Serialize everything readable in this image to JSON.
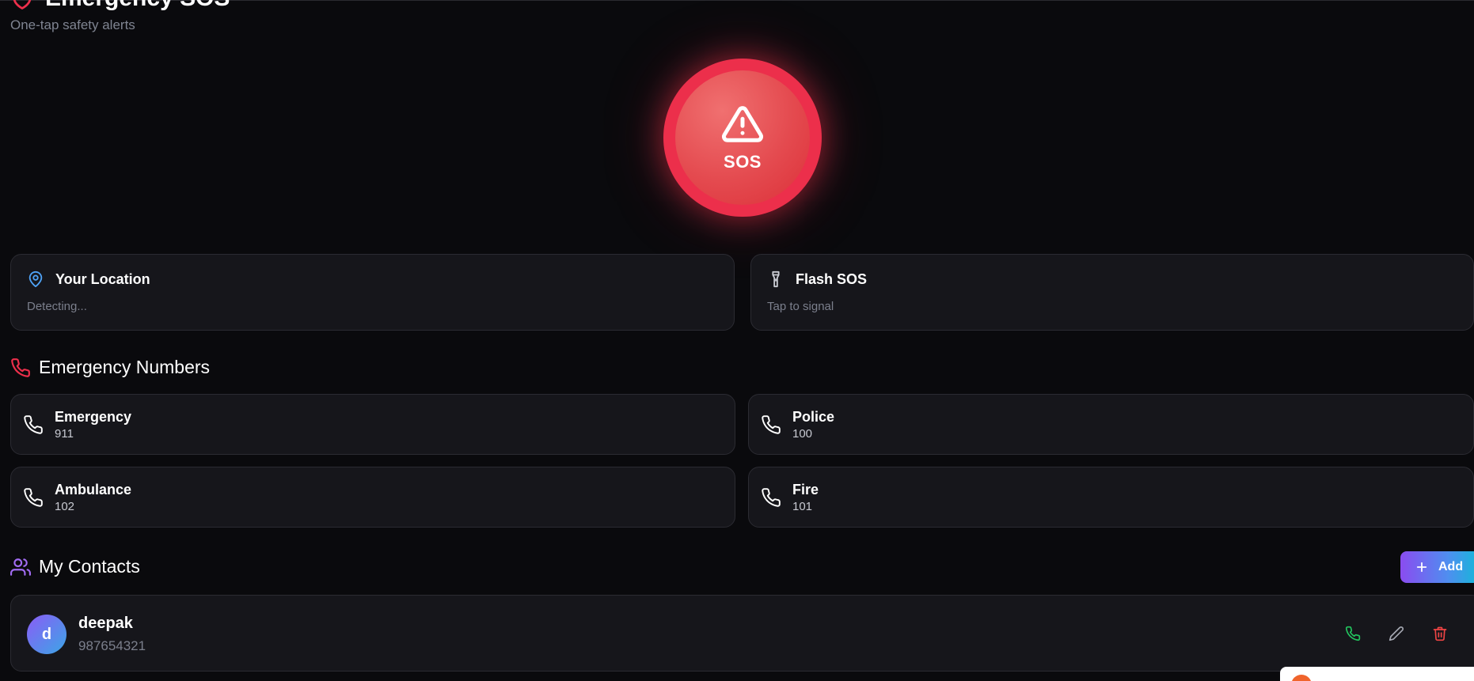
{
  "header": {
    "title": "Emergency SOS",
    "subtitle": "One-tap safety alerts"
  },
  "sos": {
    "label": "SOS"
  },
  "location": {
    "title": "Your Location",
    "status": "Detecting..."
  },
  "flash": {
    "title": "Flash SOS",
    "hint": "Tap to signal"
  },
  "emergency_numbers": {
    "title": "Emergency Numbers",
    "items": [
      {
        "name": "Emergency",
        "number": "911"
      },
      {
        "name": "Police",
        "number": "100"
      },
      {
        "name": "Ambulance",
        "number": "102"
      },
      {
        "name": "Fire",
        "number": "101"
      }
    ]
  },
  "contacts": {
    "title": "My Contacts",
    "add_label": "Add",
    "items": [
      {
        "initial": "d",
        "name": "deepak",
        "phone": "987654321"
      }
    ]
  },
  "colors": {
    "accent_red": "#ec2f4b",
    "call_green": "#22c55e",
    "delete_red": "#ef4444",
    "location_blue": "#4fa3f7",
    "contacts_purple": "#a16cf2"
  },
  "icons": {
    "header": "shield-icon",
    "sos": "warning-triangle-icon",
    "location": "map-pin-icon",
    "flash": "flashlight-icon",
    "numbers": "phone-icon",
    "contacts": "users-icon",
    "add": "plus-icon",
    "call": "phone-icon",
    "edit": "pencil-icon",
    "delete": "trash-icon"
  }
}
